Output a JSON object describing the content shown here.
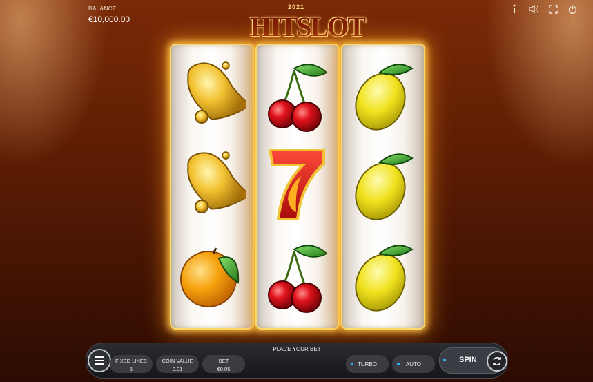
{
  "balance": {
    "label": "BALANCE",
    "value": "€10,000.00"
  },
  "logo": {
    "year": "2021",
    "title": "HITSLOT"
  },
  "top_icons": [
    "info-icon",
    "sound-icon",
    "fullscreen-icon",
    "power-icon"
  ],
  "reels": [
    [
      "bell",
      "bell",
      "orange"
    ],
    [
      "cherries",
      "seven",
      "cherries"
    ],
    [
      "lemon",
      "lemon",
      "lemon"
    ]
  ],
  "bottom_bar": {
    "title": "PLACE YOUR BET",
    "fixed_lines": {
      "label": "FIXED LINES",
      "value": "5"
    },
    "coin_value": {
      "label": "COIN VALUE",
      "value": "0.01"
    },
    "bet": {
      "label": "BET",
      "value": "€0.05"
    },
    "turbo_label": "TURBO",
    "auto_label": "AUTO",
    "spin_label": "SPIN"
  },
  "colors": {
    "accent": "#2bb7ff",
    "reel_glow": "#ffd86a",
    "background": "#7a2a06"
  }
}
